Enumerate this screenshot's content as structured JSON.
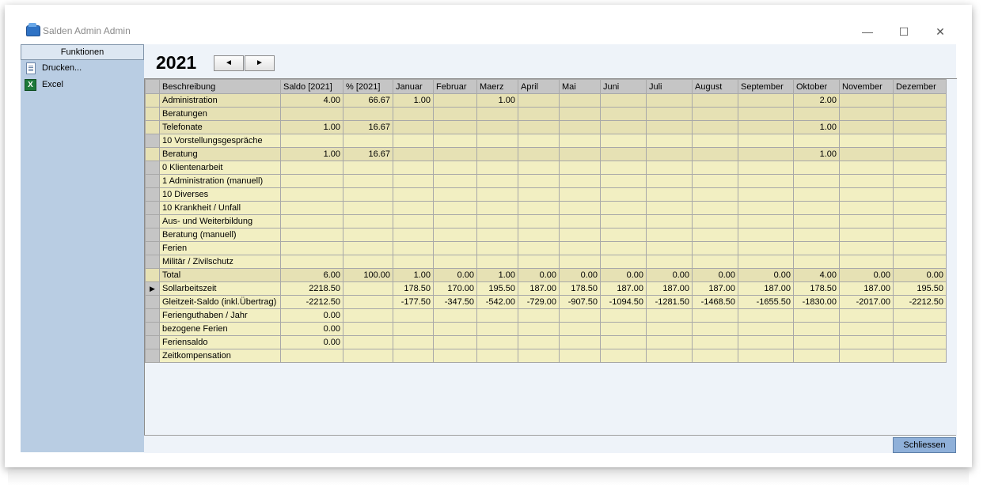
{
  "window": {
    "title": "Salden Admin Admin",
    "minimize": "—",
    "maximize": "☐",
    "close": "✕"
  },
  "sidebar": {
    "header": "Funktionen",
    "items": [
      {
        "label": "Drucken...",
        "icon": "document-icon"
      },
      {
        "label": "Excel",
        "icon": "excel-icon"
      }
    ]
  },
  "year_nav": {
    "year": "2021",
    "prev": "◄",
    "next": "►"
  },
  "table": {
    "columns": [
      "Beschreibung",
      "Saldo [2021]",
      "% [2021]",
      "Januar",
      "Februar",
      "Maerz",
      "April",
      "Mai",
      "Juni",
      "Juli",
      "August",
      "September",
      "Oktober",
      "November",
      "Dezember"
    ],
    "rows": [
      [
        "Administration",
        "4.00",
        "66.67",
        "1.00",
        "",
        "1.00",
        "",
        "",
        "",
        "",
        "",
        "",
        "2.00",
        "",
        ""
      ],
      [
        "Beratungen",
        "",
        "",
        "",
        "",
        "",
        "",
        "",
        "",
        "",
        "",
        "",
        "",
        "",
        ""
      ],
      [
        "Telefonate",
        "1.00",
        "16.67",
        "",
        "",
        "",
        "",
        "",
        "",
        "",
        "",
        "",
        "1.00",
        "",
        ""
      ],
      [
        "10 Vorstellungsgespräche",
        "",
        "",
        "",
        "",
        "",
        "",
        "",
        "",
        "",
        "",
        "",
        "",
        "",
        ""
      ],
      [
        "Beratung",
        "1.00",
        "16.67",
        "",
        "",
        "",
        "",
        "",
        "",
        "",
        "",
        "",
        "1.00",
        "",
        ""
      ],
      [
        "0 Klientenarbeit",
        "",
        "",
        "",
        "",
        "",
        "",
        "",
        "",
        "",
        "",
        "",
        "",
        "",
        ""
      ],
      [
        "1 Administration (manuell)",
        "",
        "",
        "",
        "",
        "",
        "",
        "",
        "",
        "",
        "",
        "",
        "",
        "",
        ""
      ],
      [
        "10 Diverses",
        "",
        "",
        "",
        "",
        "",
        "",
        "",
        "",
        "",
        "",
        "",
        "",
        "",
        ""
      ],
      [
        "10 Krankheit / Unfall",
        "",
        "",
        "",
        "",
        "",
        "",
        "",
        "",
        "",
        "",
        "",
        "",
        "",
        ""
      ],
      [
        "Aus- und Weiterbildung",
        "",
        "",
        "",
        "",
        "",
        "",
        "",
        "",
        "",
        "",
        "",
        "",
        "",
        ""
      ],
      [
        "Beratung (manuell)",
        "",
        "",
        "",
        "",
        "",
        "",
        "",
        "",
        "",
        "",
        "",
        "",
        "",
        ""
      ],
      [
        "Ferien",
        "",
        "",
        "",
        "",
        "",
        "",
        "",
        "",
        "",
        "",
        "",
        "",
        "",
        ""
      ],
      [
        "Militär / Zivilschutz",
        "",
        "",
        "",
        "",
        "",
        "",
        "",
        "",
        "",
        "",
        "",
        "",
        "",
        ""
      ],
      [
        "Total",
        "6.00",
        "100.00",
        "1.00",
        "0.00",
        "1.00",
        "0.00",
        "0.00",
        "0.00",
        "0.00",
        "0.00",
        "0.00",
        "4.00",
        "0.00",
        "0.00"
      ],
      [
        "Sollarbeitszeit",
        "2218.50",
        "",
        "178.50",
        "170.00",
        "195.50",
        "187.00",
        "178.50",
        "187.00",
        "187.00",
        "187.00",
        "187.00",
        "178.50",
        "187.00",
        "195.50"
      ],
      [
        "Gleitzeit-Saldo (inkl.Übertrag)",
        "-2212.50",
        "",
        "-177.50",
        "-347.50",
        "-542.00",
        "-729.00",
        "-907.50",
        "-1094.50",
        "-1281.50",
        "-1468.50",
        "-1655.50",
        "-1830.00",
        "-2017.00",
        "-2212.50"
      ],
      [
        "Ferienguthaben / Jahr",
        "0.00",
        "",
        "",
        "",
        "",
        "",
        "",
        "",
        "",
        "",
        "",
        "",
        "",
        ""
      ],
      [
        "bezogene Ferien",
        "0.00",
        "",
        "",
        "",
        "",
        "",
        "",
        "",
        "",
        "",
        "",
        "",
        "",
        ""
      ],
      [
        "Feriensaldo",
        "0.00",
        "",
        "",
        "",
        "",
        "",
        "",
        "",
        "",
        "",
        "",
        "",
        "",
        ""
      ],
      [
        "Zeitkompensation",
        "",
        "",
        "",
        "",
        "",
        "",
        "",
        "",
        "",
        "",
        "",
        "",
        "",
        ""
      ]
    ],
    "current_row_index": 14,
    "current_row_marker": "▶"
  },
  "footer": {
    "close_label": "Schliessen"
  },
  "colors": {
    "cell": "#f2efc2",
    "cell_tint": "#e6e1b4",
    "header": "#c5c5c5",
    "sidebar": "#b9cde3",
    "close_button": "#8fb0d9"
  }
}
